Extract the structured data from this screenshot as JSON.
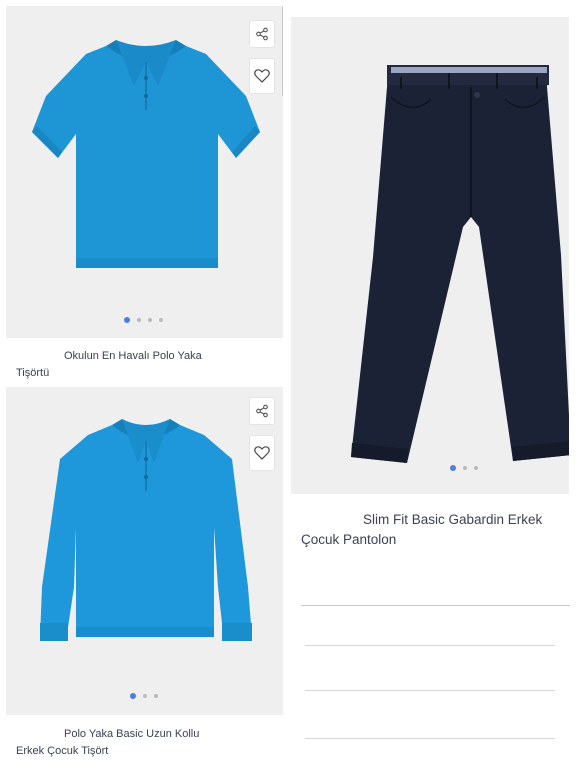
{
  "products": [
    {
      "title": "Okulun En Havalı Polo Yaka Tişörtü",
      "title_line1": "Okulun En Havalı Polo Yaka",
      "title_line2": "Tişörtü",
      "image": "blue-short-sleeve-polo-shirt",
      "color": "#1e96d6",
      "carousel_total": 4,
      "carousel_active": 1
    },
    {
      "title": "Slim Fit Basic Gabardin Erkek Çocuk Pantolon",
      "title_line1": "Slim Fit Basic Gabardin Erkek",
      "title_line2": "Çocuk Pantolon",
      "image": "navy-gabardine-trousers",
      "color": "#1c2236",
      "carousel_total": 3,
      "carousel_active": 1
    },
    {
      "title": "Polo Yaka Basic Uzun Kollu Erkek Çocuk Tişört",
      "title_line1": "Polo Yaka Basic Uzun Kollu",
      "title_line2": "Erkek Çocuk Tişört",
      "image": "blue-long-sleeve-polo-shirt",
      "color": "#1e98da",
      "carousel_total": 3,
      "carousel_active": 1
    }
  ],
  "icons": {
    "share": "share-icon",
    "favorite": "heart-icon"
  },
  "colors": {
    "card_background": "#efefef",
    "carousel_active": "#4a7fe0",
    "carousel_inactive": "#b9b9b9",
    "title_text": "#3b4156"
  }
}
